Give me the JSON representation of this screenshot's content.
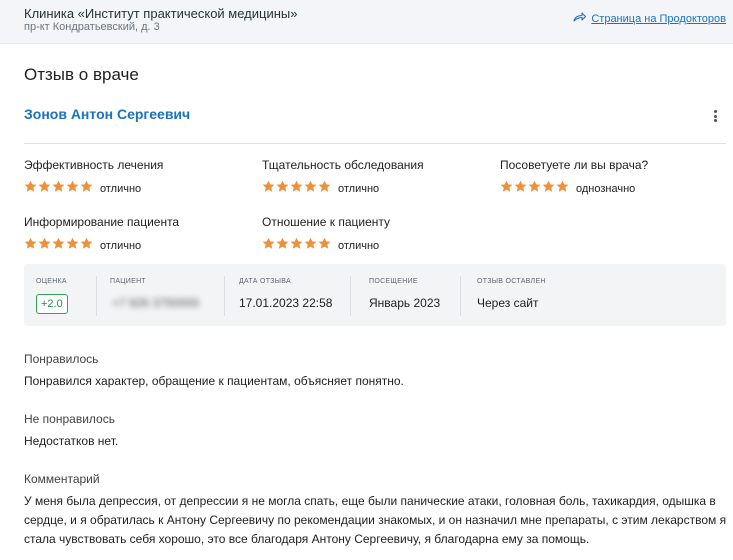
{
  "clinic": {
    "name": "Клиника «Институт практической медицины»",
    "address": "пр-кт Кондратьевский, д. 3",
    "link_label": "Страница на Продокторов"
  },
  "review": {
    "section_title": "Отзыв о враче",
    "doctor_name": "Зонов Антон Сергеевич",
    "ratings": [
      {
        "label": "Эффективность лечения",
        "stars": 5,
        "value": "отлично"
      },
      {
        "label": "Тщательность обследования",
        "stars": 5,
        "value": "отлично"
      },
      {
        "label": "Посоветуете ли вы врача?",
        "stars": 5,
        "value": "однозначно"
      },
      {
        "label": "Информирование пациента",
        "stars": 5,
        "value": "отлично"
      },
      {
        "label": "Отношение к пациенту",
        "stars": 5,
        "value": "отлично"
      }
    ],
    "meta": {
      "score_label": "ОЦЕНКА",
      "score_value": "+2.0",
      "patient_label": "ПАЦИЕНТ",
      "patient_value": "+7 926 3750000",
      "date_label": "ДАТА ОТЗЫВА",
      "date_value": "17.01.2023 22:58",
      "visit_label": "ПОСЕЩЕНИЕ",
      "visit_value": "Январь 2023",
      "source_label": "ОТЗЫВ ОСТАВЛЕН",
      "source_value": "Через сайт"
    },
    "liked_label": "Понравилось",
    "liked_text": "Понравился характер, обращение к пациентам, объясняет понятно.",
    "disliked_label": "Не понравилось",
    "disliked_text": "Недостатков нет.",
    "comment_label": "Комментарий",
    "comment_text": "У меня была депрессия, от депрессии я не могла спать, еще были панические атаки, головная боль, тахикардия, одышка в сердце, и я обратилась к Антону Сергеевичу по рекомендации знакомых, и он назначил мне препараты, с этим лекарством я стала чувствовать себя хорошо, это все благодаря Антону Сергеевичу, я благодарна ему за помощь."
  },
  "colors": {
    "accent": "#1a73c0",
    "star": "#f0913a",
    "badge_green": "#2fa45a",
    "panel_bg": "#f3f4f6"
  },
  "icons": [
    "share-arrow-icon",
    "more-vertical-icon",
    "star-icon"
  ]
}
